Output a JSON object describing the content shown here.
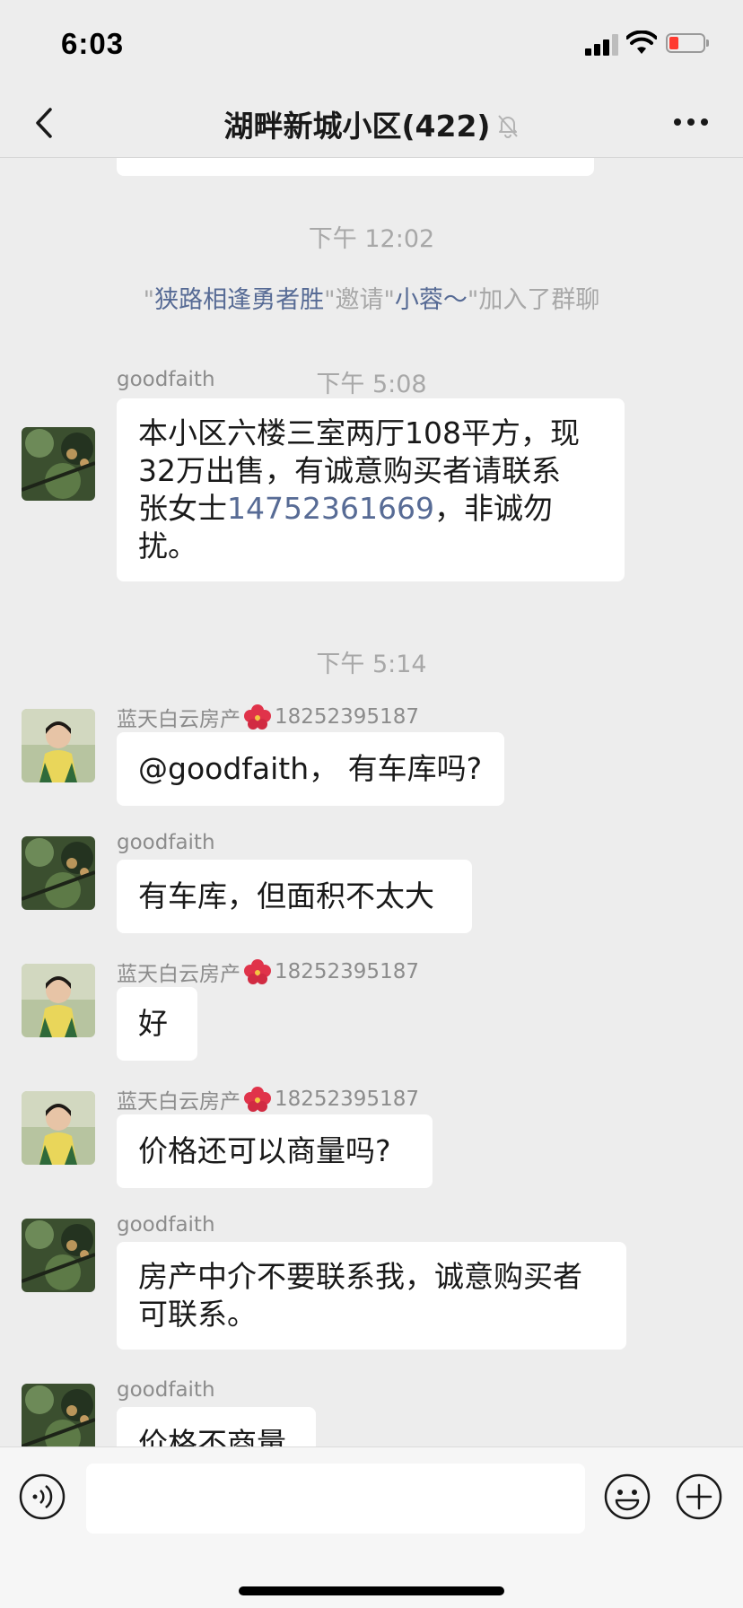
{
  "status_bar": {
    "time": "6:03"
  },
  "nav": {
    "title": "湖畔新城小区(422)"
  },
  "chat": {
    "timestamps": [
      "下午 12:02",
      "下午 5:08",
      "下午 5:14"
    ],
    "system_message": {
      "q1": "\"",
      "inviter": "狭路相逢勇者胜",
      "q2": "\"邀请\"",
      "invitee": "小蓉～",
      "q3": "\"加入了群聊"
    },
    "messages": [
      {
        "sender": "goodfaith",
        "lines": [
          "本小区六楼三室两厅108平方，现",
          "32万出售，有诚意购买者请联系"
        ],
        "line3_prefix": "张女士",
        "phone": "14752361669",
        "line3_suffix": "，非诚勿扰。"
      },
      {
        "sender_name": "蓝天白云房产",
        "sender_phone": "18252395187",
        "text": "@goodfaith， 有车库吗?"
      },
      {
        "sender": "goodfaith",
        "text": "有车库，但面积不太大"
      },
      {
        "sender_name": "蓝天白云房产",
        "sender_phone": "18252395187",
        "text": "好"
      },
      {
        "sender_name": "蓝天白云房产",
        "sender_phone": "18252395187",
        "text": "价格还可以商量吗?"
      },
      {
        "sender": "goodfaith",
        "lines": [
          "房产中介不要联系我，诚意购买者",
          "可联系。"
        ]
      },
      {
        "sender": "goodfaith",
        "text": "价格不商量"
      }
    ]
  },
  "input": {
    "value": ""
  },
  "icons": {
    "back": "chevron-left-icon",
    "mute": "bell-off-icon",
    "more": "more-dots-icon",
    "voice": "voice-icon",
    "emoji": "emoji-icon",
    "plus": "plus-icon",
    "flower": "hibiscus-icon"
  },
  "colors": {
    "background": "#ededed",
    "bubble": "#ffffff",
    "link": "#576b95",
    "meta": "#a8a8a8"
  }
}
